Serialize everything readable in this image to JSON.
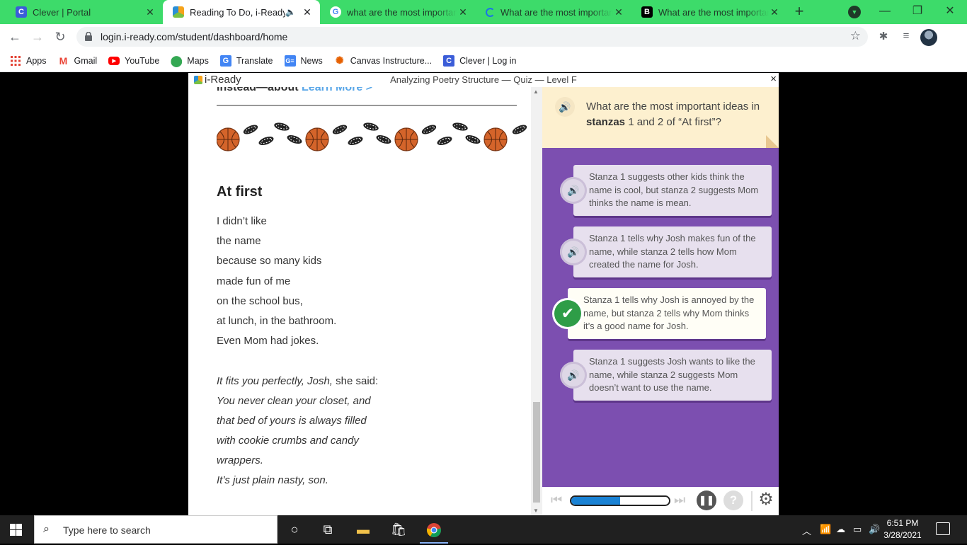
{
  "browser": {
    "tabs": [
      {
        "title": "Clever | Portal",
        "favicon": "C",
        "active": false
      },
      {
        "title": "Reading To Do, i-Ready",
        "favicon": "iready",
        "active": true,
        "audio": true
      },
      {
        "title": "what are the most important",
        "favicon": "G",
        "active": false
      },
      {
        "title": "What are the most important",
        "favicon": "loading",
        "active": false
      },
      {
        "title": "What are the most important",
        "favicon": "B",
        "active": false
      }
    ],
    "url": "login.i-ready.com/student/dashboard/home",
    "bookmarks": [
      {
        "label": "Apps",
        "icon": "apps-grid-icon"
      },
      {
        "label": "Gmail",
        "icon": "gmail-icon"
      },
      {
        "label": "YouTube",
        "icon": "youtube-icon"
      },
      {
        "label": "Maps",
        "icon": "maps-icon"
      },
      {
        "label": "Translate",
        "icon": "translate-icon"
      },
      {
        "label": "News",
        "icon": "news-icon"
      },
      {
        "label": "Canvas Instructure...",
        "icon": "canvas-icon"
      },
      {
        "label": "Clever | Log in",
        "icon": "clever-icon"
      }
    ]
  },
  "lesson": {
    "brand": "i-Ready",
    "title": "Analyzing Poetry Structure — Quiz — Level F",
    "close": "×"
  },
  "reader": {
    "cut_text": "Instead—about",
    "cut_link": "Learn More >",
    "poem_title": "At first",
    "stanza1": [
      "I didn’t like",
      "the name",
      "because so many kids",
      "made fun of me",
      "on the school bus,",
      "at lunch, in the bathroom.",
      "Even Mom had jokes."
    ],
    "stanza2_first_italic": "It fits you perfectly, Josh,",
    "stanza2_first_plain": " she said:",
    "stanza2": [
      "You never clean your closet, and",
      "that bed of yours is always filled",
      "with cookie crumbs and candy",
      "wrappers.",
      "It’s just plain nasty, son."
    ]
  },
  "question": {
    "prefix": "What are the most important ideas in ",
    "bold": "stanzas",
    "suffix": " 1 and 2 of “At first”?",
    "answers": [
      {
        "text": "Stanza 1 suggests other kids think the name is cool, but stanza 2 suggests Mom thinks the name is mean.",
        "selected": false
      },
      {
        "text": "Stanza 1 tells why Josh makes fun of the name, while stanza 2 tells how Mom created the name for Josh.",
        "selected": false
      },
      {
        "text": "Stanza 1 tells why Josh is annoyed by the name, but stanza 2 tells why Mom thinks it’s a good name for Josh.",
        "selected": true
      },
      {
        "text": "Stanza 1 suggests Josh wants to like the name, while stanza 2 suggests Mom doesn’t want to use the name.",
        "selected": false
      }
    ]
  },
  "player": {
    "progress": 0.5,
    "help": "?"
  },
  "taskbar": {
    "search_placeholder": "Type here to search",
    "time": "6:51 PM",
    "date": "3/28/2021"
  },
  "colors": {
    "tab_strip": "#3ddb6a",
    "panel_purple": "#7c4fb0",
    "question_bg": "#fdf0cf",
    "correct_green": "#2e9d47",
    "progress_blue": "#1a82d4"
  }
}
